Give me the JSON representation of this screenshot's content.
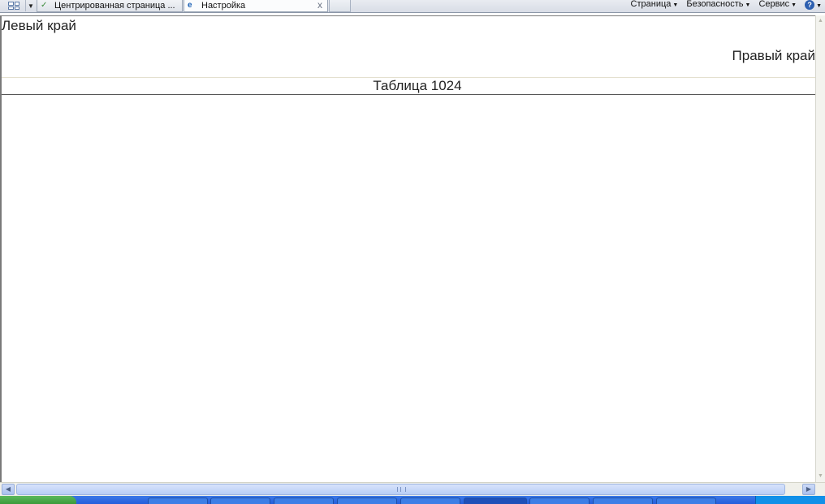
{
  "tabbar": {
    "tabs": [
      {
        "label": "Центрированная страница ...",
        "active": false,
        "icon": "green-page-icon"
      },
      {
        "label": "Настройка",
        "active": true,
        "icon": "ie-logo-icon"
      }
    ],
    "close_glyph": "x"
  },
  "command_bar": {
    "items": [
      {
        "label": "Страница"
      },
      {
        "label": "Безопасность"
      },
      {
        "label": "Сервис"
      }
    ],
    "help_glyph": "?"
  },
  "page": {
    "left_edge_text": "Левый край",
    "right_edge_text": "Правый край",
    "table_text": "Таблица 1024"
  },
  "colors": {
    "content_background": "#ffffff",
    "taskbar_blue": "#245edc",
    "start_green": "#3a9a3a"
  }
}
